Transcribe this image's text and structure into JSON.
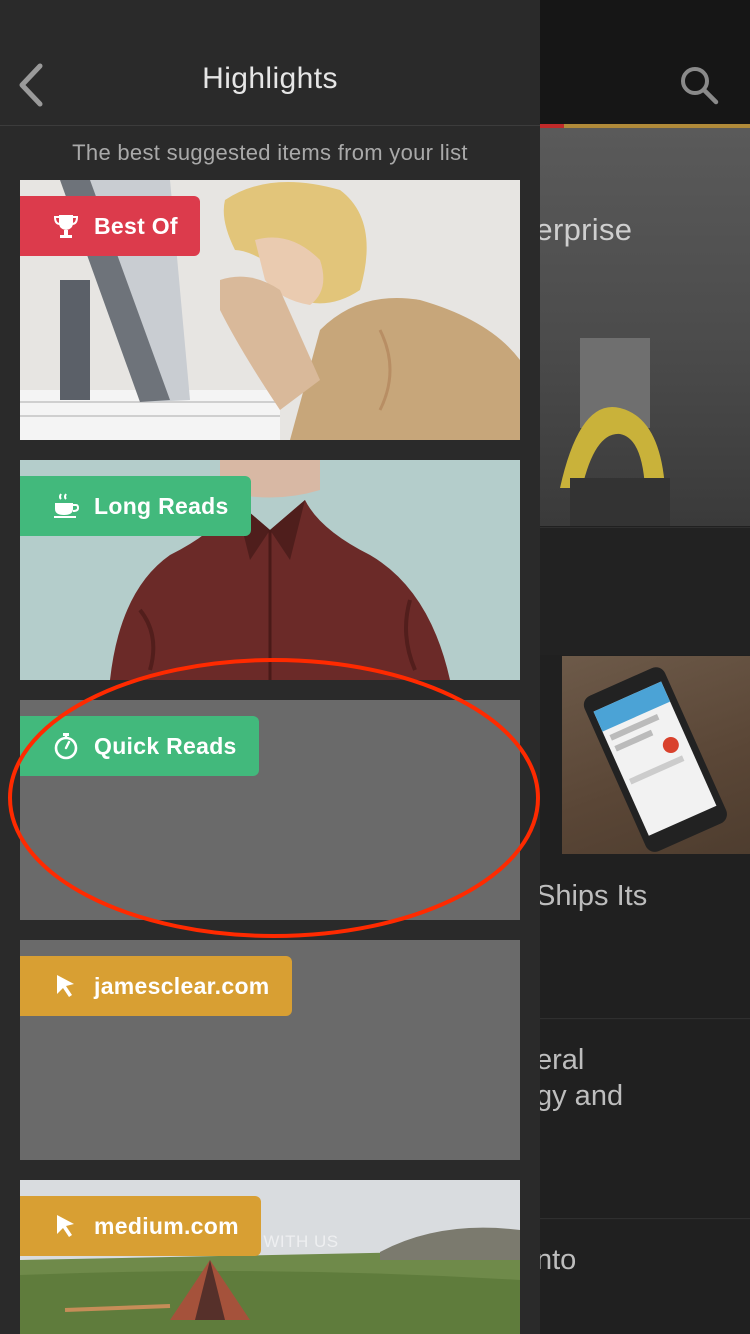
{
  "background": {
    "hero_title": "Enterprise",
    "row_texts": [
      "Ships Its",
      "eral",
      "gy and",
      "nto"
    ],
    "search_icon": "search-icon"
  },
  "drawer": {
    "title": "Highlights",
    "subtitle": "The best suggested items from your list",
    "back_icon": "chevron-left-icon"
  },
  "cards": [
    {
      "label": "Best Of",
      "icon": "trophy-icon",
      "color": "#dc3b4c"
    },
    {
      "label": "Long Reads",
      "icon": "coffee-cup-icon",
      "color": "#42b97c"
    },
    {
      "label": "Quick Reads",
      "icon": "stopwatch-icon",
      "color": "#42b97c"
    },
    {
      "label": "jamesclear.com",
      "icon": "cursor-icon",
      "color": "#d89f33"
    },
    {
      "label": "medium.com",
      "icon": "cursor-icon",
      "color": "#d89f33"
    }
  ],
  "card5_overlay_text": "SIGN UP WITH US",
  "annotation": {
    "color": "#ff2a00",
    "target": "Quick Reads"
  }
}
